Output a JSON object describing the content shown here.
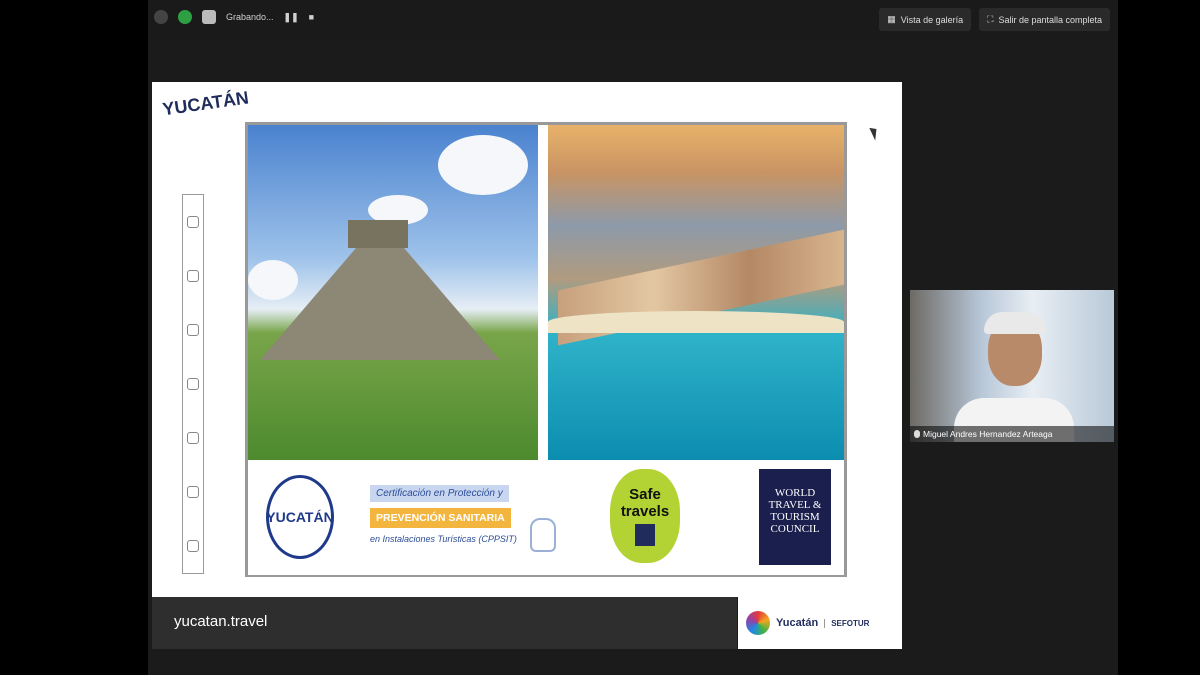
{
  "topbar": {
    "recording_label": "Grabando...",
    "gallery_label": "Vista de galería",
    "exit_fullscreen_label": "Salir de pantalla completa"
  },
  "slide": {
    "brand": "YUCATÁN",
    "cert": {
      "seal_text": "YUCATÁN",
      "line1": "Certificación en Protección y",
      "line2": "PREVENCIÓN SANITARIA",
      "line3": "en Instalaciones Turísticas (CPPSIT)"
    },
    "safe_travels": {
      "line1": "Safe",
      "line2": "travels"
    },
    "wttc": {
      "line1": "WORLD",
      "line2": "TRAVEL &",
      "line3": "TOURISM",
      "line4": "COUNCIL"
    }
  },
  "bottom": {
    "url": "yucatan.travel",
    "gov_name": "Yucatán",
    "gov_agency": "SEFOTUR"
  },
  "participant": {
    "name": "Miguel Andres Hernandez Arteaga"
  },
  "colors": {
    "topbar": "#1a1a1a",
    "accent_green": "#b3d334",
    "brand_navy": "#1f2c5c",
    "cert_orange": "#f4b53f"
  }
}
